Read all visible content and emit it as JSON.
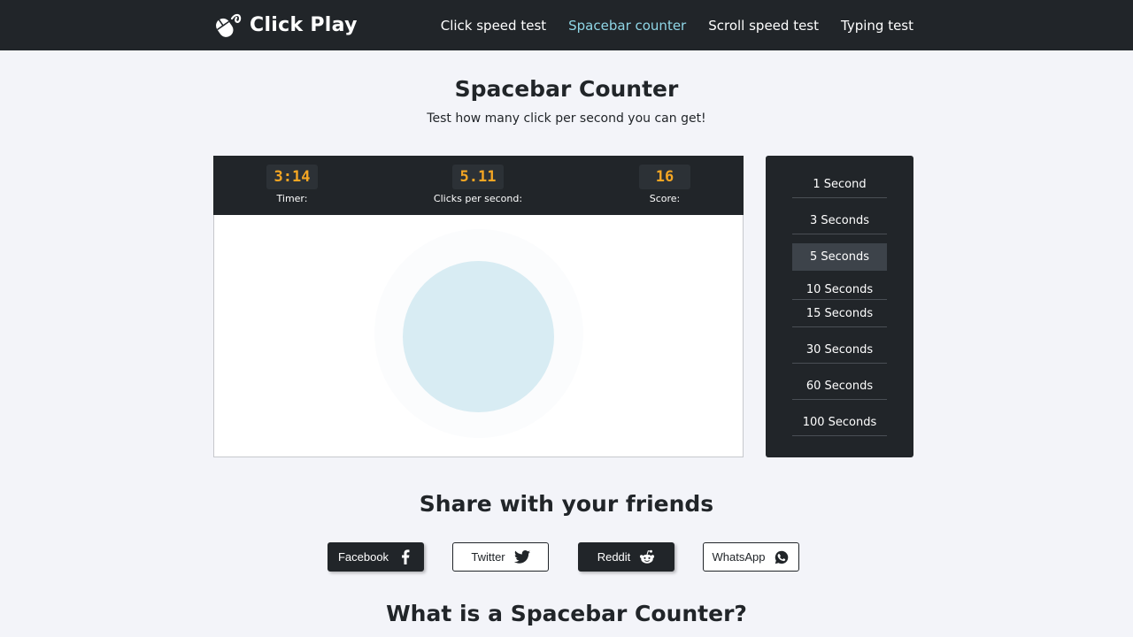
{
  "nav": {
    "brand": "Click Play",
    "links": [
      {
        "label": "Click speed test",
        "active": false
      },
      {
        "label": "Spacebar counter",
        "active": true
      },
      {
        "label": "Scroll speed test",
        "active": false
      },
      {
        "label": "Typing test",
        "active": false
      }
    ]
  },
  "header": {
    "title": "Spacebar Counter",
    "subtitle": "Test how many click per second you can get!"
  },
  "stats": {
    "timer": {
      "value": "3:14",
      "label": "Timer:"
    },
    "cps": {
      "value": "5.11",
      "label": "Clicks per second:"
    },
    "score": {
      "value": "16",
      "label": "Score:"
    }
  },
  "durations": {
    "items": [
      "1 Second",
      "3 Seconds",
      "5 Seconds",
      "10 Seconds",
      "15 Seconds",
      "30 Seconds",
      "60 Seconds",
      "100 Seconds"
    ],
    "selected": "5 Seconds"
  },
  "share": {
    "title": "Share with your friends",
    "facebook": "Facebook",
    "twitter": "Twitter",
    "reddit": "Reddit",
    "whatsapp": "WhatsApp"
  },
  "section": {
    "heading": "What is a Spacebar Counter?"
  },
  "colors": {
    "nav_bg": "#212529",
    "active_link": "#8fd6e6",
    "stat_value": "#f5a623",
    "target_circle": "#d8ecf3",
    "page_bg": "#f3f4f9"
  },
  "icons": {
    "brand": "mouse-icon",
    "facebook": "facebook-icon",
    "twitter": "twitter-icon",
    "reddit": "reddit-icon",
    "whatsapp": "whatsapp-icon"
  }
}
